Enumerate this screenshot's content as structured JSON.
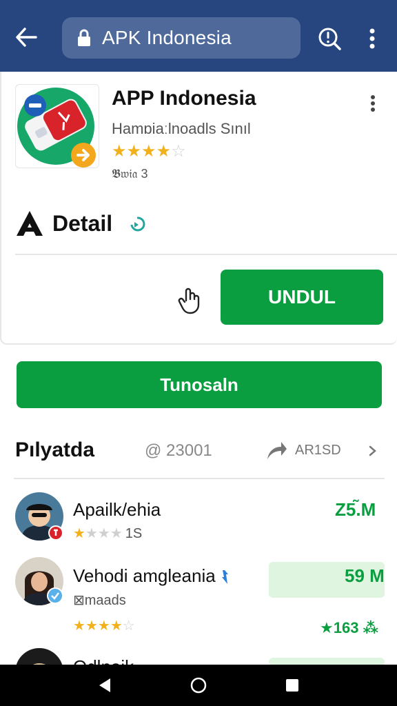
{
  "browser": {
    "url_text": "APK Indonesia",
    "back_icon": "arrow-left-icon",
    "lock_icon": "lock-icon",
    "alert_icon": "search-alert-icon",
    "menu_icon": "more-vertical-icon"
  },
  "app": {
    "title": "APP Indonesia",
    "subtitle": "Hamɒiaːlnoadls Sınıl",
    "rating_stars": 4,
    "rating_max": 5,
    "meta": "𝕭𝔴𝔦𝔞 3",
    "detail_label": "Detail",
    "download_label": "UNDUL",
    "colors": {
      "accent": "#0b9e41",
      "topbar": "#27467f",
      "star": "#f2b11b"
    }
  },
  "primary_button": {
    "label": "Tunosaln"
  },
  "section": {
    "title": "Pılyatda",
    "count": "@ 23001",
    "share_label": "AR1SD"
  },
  "items": [
    {
      "name": "Apailk/ehia",
      "stars": 1,
      "count": "1S",
      "size": "Z5.̃M"
    },
    {
      "name": "Vehodi amgleania",
      "sub": "⊠maads",
      "stars": 4,
      "size": "59 M",
      "rating_text": "★163 ⁂"
    },
    {
      "name": "Odlnaik"
    }
  ]
}
